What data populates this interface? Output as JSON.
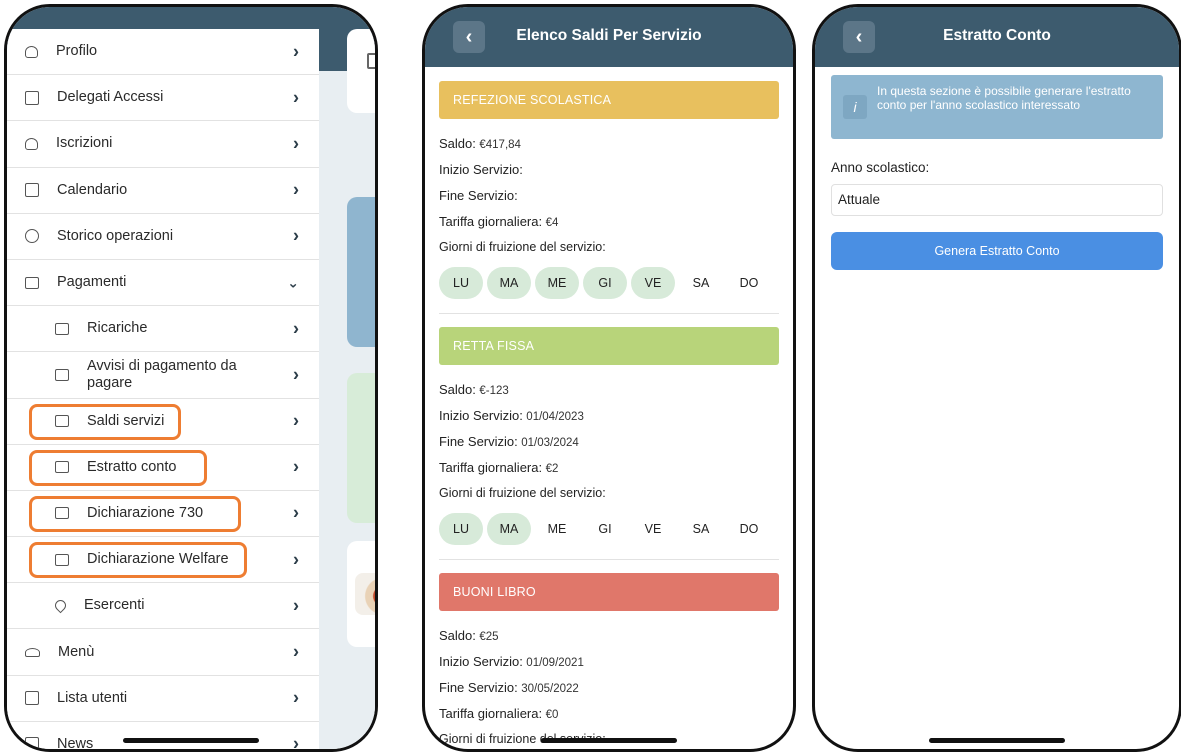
{
  "phone1": {
    "menu": [
      {
        "label": "Profilo",
        "icon": "person-icon",
        "sub": false
      },
      {
        "label": "Delegati Accessi",
        "icon": "document-icon",
        "sub": false
      },
      {
        "label": "Iscrizioni",
        "icon": "person-icon",
        "sub": false
      },
      {
        "label": "Calendario",
        "icon": "calendar-icon",
        "sub": false
      },
      {
        "label": "Storico operazioni",
        "icon": "clock-icon",
        "sub": false
      },
      {
        "label": "Pagamenti",
        "icon": "wallet-icon",
        "sub": false,
        "expanded": true
      },
      {
        "label": "Ricariche",
        "icon": "wallet-icon",
        "sub": true
      },
      {
        "label": "Avvisi di pagamento da pagare",
        "icon": "wallet-icon",
        "sub": true
      },
      {
        "label": "Saldi servizi",
        "icon": "wallet-icon",
        "sub": true,
        "highlighted": true
      },
      {
        "label": "Estratto conto",
        "icon": "wallet-icon",
        "sub": true,
        "highlighted": true
      },
      {
        "label": "Dichiarazione 730",
        "icon": "wallet-icon",
        "sub": true,
        "highlighted": true
      },
      {
        "label": "Dichiarazione Welfare",
        "icon": "wallet-icon",
        "sub": true,
        "highlighted": true
      },
      {
        "label": "Esercenti",
        "icon": "pin-icon",
        "sub": true
      },
      {
        "label": "Menù",
        "icon": "dish-icon",
        "sub": false
      },
      {
        "label": "Lista utenti",
        "icon": "document-icon",
        "sub": false
      },
      {
        "label": "News",
        "icon": "document-icon",
        "sub": false
      }
    ],
    "chevron": "›",
    "chevron_down": "⌄",
    "highlight_color": "#ee7d32"
  },
  "phone2": {
    "back": "‹",
    "title": "Elenco Saldi Per Servizio",
    "labels": {
      "saldo": "Saldo:",
      "inizio": "Inizio Servizio:",
      "fine": "Fine Servizio:",
      "tariffa": "Tariffa giornaliera:",
      "giorni": "Giorni di fruizione del servizio:"
    },
    "services": [
      {
        "name": "REFEZIONE SCOLASTICA",
        "color": "#e8c05e",
        "saldo": "€417,84",
        "inizio": "",
        "fine": "",
        "tariffa": "€4",
        "days": [
          {
            "d": "LU",
            "on": true
          },
          {
            "d": "MA",
            "on": true
          },
          {
            "d": "ME",
            "on": true
          },
          {
            "d": "GI",
            "on": true
          },
          {
            "d": "VE",
            "on": true
          },
          {
            "d": "SA",
            "on": false
          },
          {
            "d": "DO",
            "on": false
          }
        ]
      },
      {
        "name": "RETTA FISSA",
        "color": "#b8d47a",
        "saldo": "€-123",
        "inizio": "01/04/2023",
        "fine": "01/03/2024",
        "tariffa": "€2",
        "days": [
          {
            "d": "LU",
            "on": true
          },
          {
            "d": "MA",
            "on": true
          },
          {
            "d": "ME",
            "on": false
          },
          {
            "d": "GI",
            "on": false
          },
          {
            "d": "VE",
            "on": false
          },
          {
            "d": "SA",
            "on": false
          },
          {
            "d": "DO",
            "on": false
          }
        ]
      },
      {
        "name": "BUONI LIBRO",
        "color": "#e0776a",
        "saldo": "€25",
        "inizio": "01/09/2021",
        "fine": "30/05/2022",
        "tariffa": "€0",
        "days": []
      }
    ]
  },
  "phone3": {
    "back": "‹",
    "title": "Estratto Conto",
    "info_icon": "i",
    "info_text": "In questa sezione è possibile generare l'estratto conto per l'anno scolastico interessato",
    "anno_label": "Anno scolastico:",
    "anno_value": "Attuale",
    "button": "Genera Estratto Conto"
  }
}
